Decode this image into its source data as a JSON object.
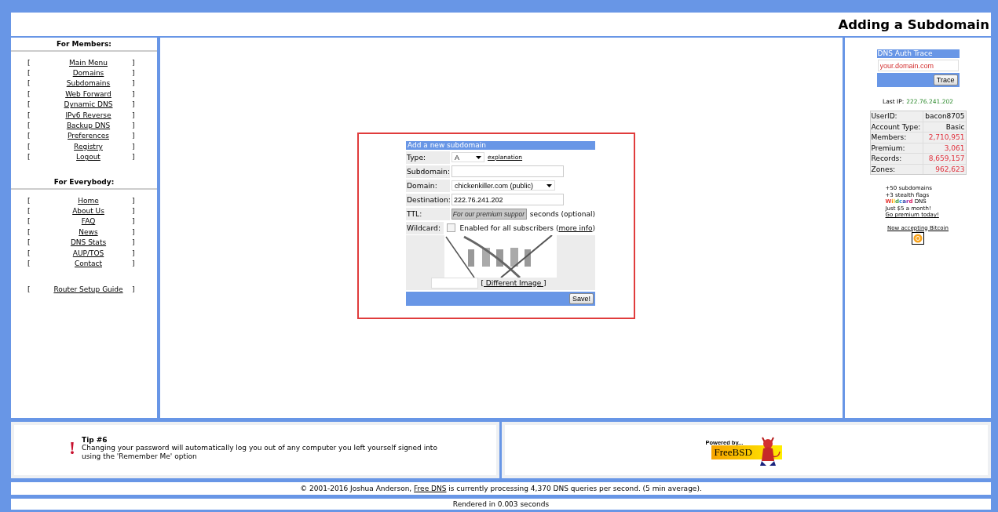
{
  "header": {
    "title": "Adding a Subdomain"
  },
  "sidebar": {
    "sections": [
      {
        "heading": "For Members:",
        "items": [
          {
            "left": "[",
            "label": "Main Menu",
            "right": "]"
          },
          {
            "left": "[",
            "label": "Domains",
            "right": "]"
          },
          {
            "left": "[",
            "label": "Subdomains",
            "right": "]"
          },
          {
            "left": "[",
            "label": "Web Forward",
            "right": "]"
          },
          {
            "left": "[",
            "label": "Dynamic DNS",
            "right": "]"
          },
          {
            "left": "[",
            "label": "IPv6 Reverse",
            "right": "]"
          },
          {
            "left": "[",
            "label": "Backup DNS",
            "right": "]"
          },
          {
            "left": "[",
            "label": "Preferences",
            "right": "]"
          },
          {
            "left": "[",
            "label": "Registry",
            "right": "]"
          },
          {
            "left": "[",
            "label": "Logout",
            "right": "]"
          }
        ]
      },
      {
        "heading": "For Everybody:",
        "items": [
          {
            "left": "[",
            "label": "Home",
            "right": "]"
          },
          {
            "left": "[",
            "label": "About Us",
            "right": "]"
          },
          {
            "left": "[",
            "label": "FAQ",
            "right": "]"
          },
          {
            "left": "[",
            "label": "News",
            "right": "]"
          },
          {
            "left": "[",
            "label": "DNS Stats",
            "right": "]"
          },
          {
            "left": "[",
            "label": "AUP/TOS",
            "right": "]"
          },
          {
            "left": "[",
            "label": "Contact",
            "right": "]"
          }
        ]
      },
      {
        "items": [
          {
            "left": "[",
            "label": "Router Setup Guide",
            "right": "]"
          }
        ]
      }
    ]
  },
  "form": {
    "title": "Add a new subdomain",
    "rows": [
      {
        "kind": "select",
        "label": "Type:",
        "value": "A",
        "link": "explanation"
      },
      {
        "kind": "input",
        "label": "Subdomain:"
      },
      {
        "kind": "select",
        "label": "Domain:",
        "value": "chickenkiller.com (public)"
      },
      {
        "kind": "input",
        "label": "Destination:",
        "value": "222.76.241.202"
      },
      {
        "kind": "disabled",
        "label": "TTL:",
        "value": "For our premium suppor",
        "suffix": "seconds (optional)"
      },
      {
        "kind": "checkbox",
        "label": "Wildcard:",
        "checked": false,
        "text": "Enabled for all subscribers (",
        "link": "more info",
        "after": ")"
      }
    ],
    "captcha": {
      "kind": "picture",
      "link": "[ Different Image ]"
    },
    "save": "Save!"
  },
  "trace": {
    "title": "DNS Auth Trace",
    "value": "your.domain.com",
    "button": "Trace"
  },
  "last_ip": {
    "label": "Last IP:",
    "value": "222.76.241.202"
  },
  "stats": [
    {
      "label": "UserID:",
      "value": "bacon8705",
      "highlighted": false
    },
    {
      "label": "Account Type:",
      "value": "Basic",
      "highlighted": false
    },
    {
      "label": "Members:",
      "value": "2,710,951",
      "highlighted": true
    },
    {
      "label": "Premium:",
      "value": "3,061",
      "highlighted": true
    },
    {
      "label": "Records:",
      "value": "8,659,157",
      "highlighted": true
    },
    {
      "label": "Zones:",
      "value": "962,623",
      "highlighted": true
    }
  ],
  "promo": [
    {
      "kind": "text",
      "text": "+50 subdomains"
    },
    {
      "kind": "text",
      "text": "+3 stealth flags"
    },
    {
      "kind": "rainbow",
      "text": "Wildcard",
      "after": " DNS"
    },
    {
      "kind": "text",
      "text": "Just $5 a month!"
    },
    {
      "kind": "link",
      "text": "Go premium today!"
    }
  ],
  "bitcoin": {
    "link": "Now accepting Bitcoin"
  },
  "tip": {
    "title": "Tip #6",
    "mark": "!",
    "text": "Changing your password will automatically log you out of any computer you left yourself signed into using the 'Remember Me' option"
  },
  "powered": {
    "top": "Powered by...",
    "name": "FreeBSD"
  },
  "footer": {
    "before": "© 2001-2016 Joshua Anderson, ",
    "link": "Free DNS",
    "after": " is currently processing 4,370 DNS queries per second. (5 min average)."
  },
  "rendered": "Rendered in 0.003 seconds"
}
